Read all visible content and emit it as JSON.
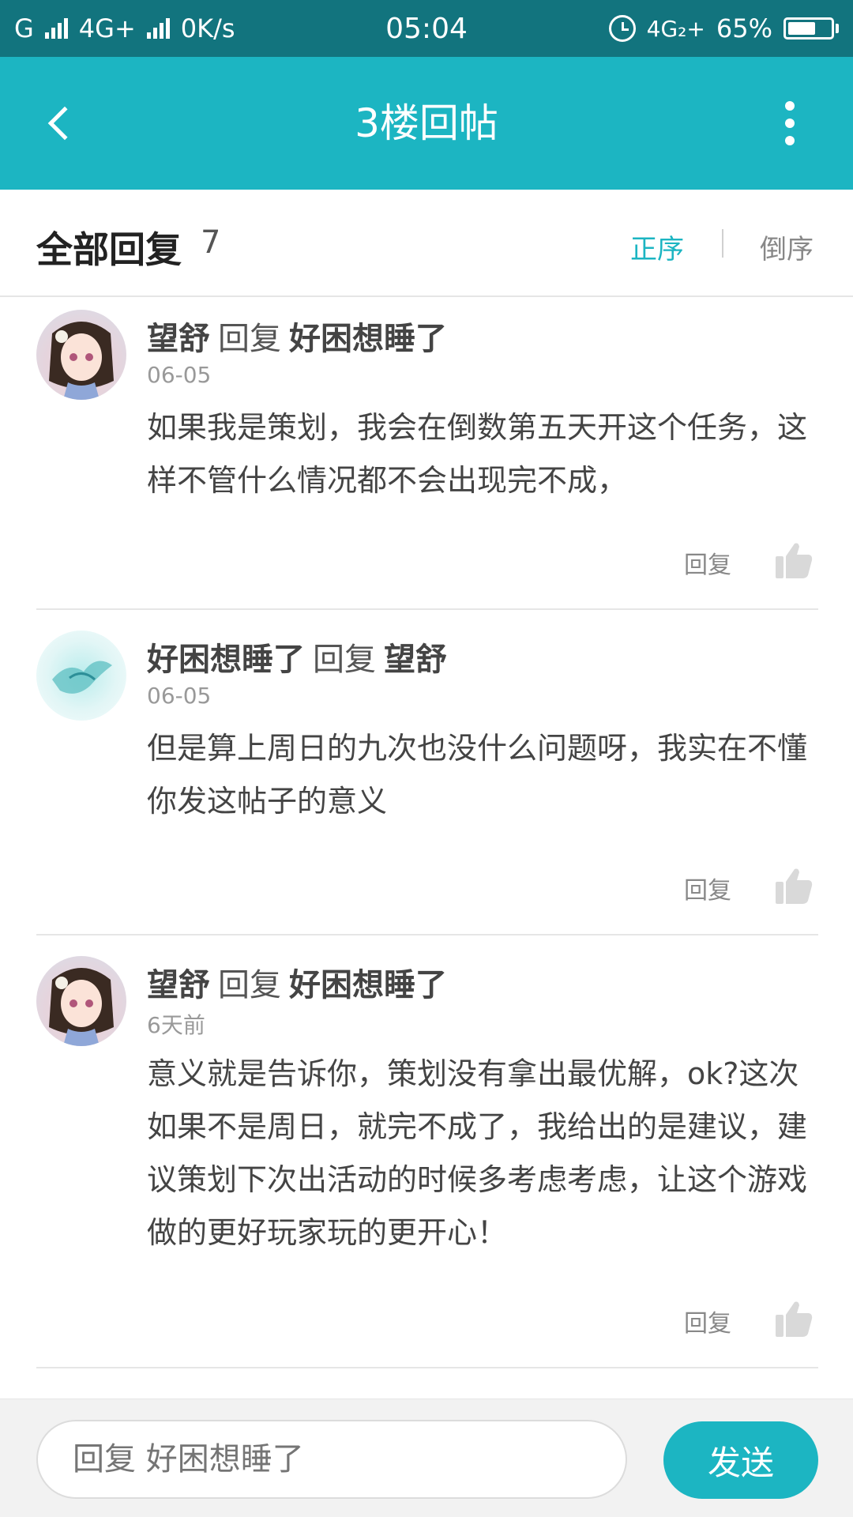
{
  "status_bar": {
    "carrier": "G",
    "network": "4G+",
    "speed": "0K/s",
    "time": "05:04",
    "network2": "4G₂+",
    "battery": "65%",
    "battery_level": 0.65
  },
  "app_bar": {
    "title": "3楼回帖",
    "back_icon": "chevron-left-icon",
    "menu_icon": "more-vertical-icon"
  },
  "replies_header": {
    "title": "全部回复",
    "count": "7",
    "sort_asc": "正序",
    "sort_desc": "倒序"
  },
  "replies": [
    {
      "author": "望舒",
      "verb": "回复",
      "target": "好困想睡了",
      "date": "06-05",
      "content": "如果我是策划，我会在倒数第五天开这个任务，这样不管什么情况都不会出现完不成，",
      "reply_label": "回复"
    },
    {
      "author": "好困想睡了",
      "verb": "回复",
      "target": "望舒",
      "date": "06-05",
      "content": "但是算上周日的九次也没什么问题呀，我实在不懂你发这帖子的意义",
      "reply_label": "回复"
    },
    {
      "author": "望舒",
      "verb": "回复",
      "target": "好困想睡了",
      "date": "6天前",
      "content": "意义就是告诉你，策划没有拿出最优解，ok?这次如果不是周日，就完不成了，我给出的是建议，建议策划下次出活动的时候多考虑考虑，让这个游戏做的更好玩家玩的更开心！",
      "reply_label": "回复"
    }
  ],
  "composer": {
    "placeholder": "回复 好困想睡了",
    "send_label": "发送"
  },
  "colors": {
    "accent": "#1cb5c2",
    "status_bar": "#12747e"
  }
}
